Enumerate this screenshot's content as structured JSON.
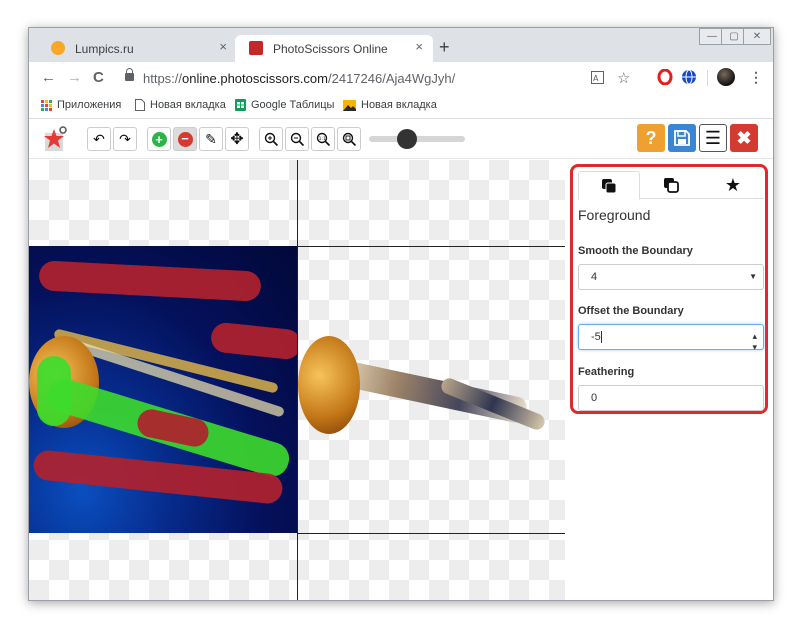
{
  "browser": {
    "tabs": [
      {
        "title": "Lumpics.ru",
        "favicon_color": "#f9a825",
        "active": false
      },
      {
        "title": "PhotoScissors Online",
        "favicon_color": "#c62828",
        "active": true
      }
    ],
    "new_tab_symbol": "+",
    "close_symbol": "×",
    "window_controls": [
      "—",
      "▢",
      "✕"
    ],
    "nav": {
      "back": "←",
      "forward": "→",
      "reload": "C"
    },
    "url_prefix": "https://",
    "url_host": "online.photoscissors.com",
    "url_path": "/2417246/Aja4WgJyh/"
  },
  "bookmarks": [
    {
      "label": "Приложения",
      "icon": "apps-grid-icon"
    },
    {
      "label": "Новая вкладка",
      "icon": "page-icon"
    },
    {
      "label": "Google Таблицы",
      "icon": "sheets-icon"
    },
    {
      "label": "Новая вкладка",
      "icon": "image-icon"
    }
  ],
  "app_toolbar": {
    "undo": "↶",
    "redo": "↷",
    "keep_marker": "+",
    "remove_marker": "−",
    "eraser": "✎",
    "move": "✥",
    "zoom_in": "+",
    "zoom_out": "−",
    "zoom_actual": "1:1",
    "zoom_fit": "⌖",
    "brush_size_fraction": 0.4,
    "help": "?",
    "save": "▣",
    "menu": "☰",
    "close": "✖",
    "colors": {
      "help": "#f0a030",
      "save": "#3a86d4",
      "close": "#d43a2f",
      "keep": "#2db34a",
      "remove": "#d43a2f"
    }
  },
  "panel": {
    "tabs": [
      "foreground-tab",
      "background-tab",
      "effects-tab"
    ],
    "section_title": "Foreground",
    "smooth_label": "Smooth the Boundary",
    "smooth_value": "4",
    "offset_label": "Offset the Boundary",
    "offset_value": "-5",
    "feather_label": "Feathering",
    "feather_value": "0",
    "highlight_color": "#dd2a2a"
  }
}
